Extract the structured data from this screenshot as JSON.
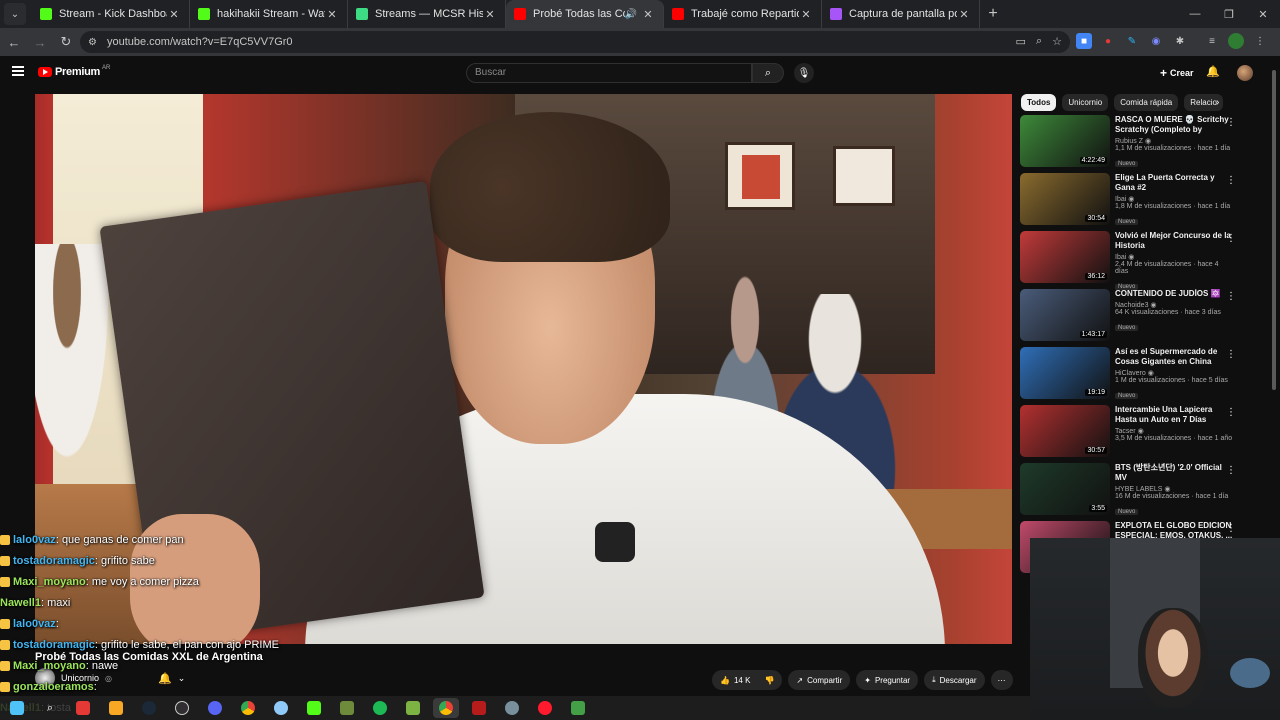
{
  "browser": {
    "tabs": [
      {
        "title": "Stream - Kick Dashboard",
        "icon": "kick-icon",
        "color": "#53fc18"
      },
      {
        "title": "hakihakii Stream - Watch Live o",
        "icon": "kick-icon",
        "color": "#53fc18"
      },
      {
        "title": "Streams — MCSR Hispano",
        "icon": "mcsr-icon",
        "color": "#3ddc84"
      },
      {
        "title": "Probé Todas las Comidas X",
        "icon": "youtube-icon",
        "color": "#ff0000",
        "active": true,
        "audio": true
      },
      {
        "title": "Trabajé como Repartidor de Co",
        "icon": "youtube-icon",
        "color": "#ff0000"
      },
      {
        "title": "Captura de pantalla por Lightsh",
        "icon": "lightshot-icon",
        "color": "#a855f7"
      }
    ],
    "url": "youtube.com/watch?v=E7qC5VV7Gr0"
  },
  "yt": {
    "logo": "Premium",
    "logo_country": "AR",
    "search_placeholder": "Buscar",
    "create_label": "Crear",
    "video_title": "Probé Todas las Comidas XXL de Argentina",
    "channel": "Unicornio",
    "likes": "14 K",
    "share": "Compartir",
    "ask": "Preguntar",
    "download": "Descargar",
    "chips": [
      "Todos",
      "Unicornio",
      "Comida rápida",
      "Relacio"
    ]
  },
  "recs": [
    {
      "title": "RASCA O MUERE 💀 Scritchy Scratchy (Completo by Rubius)",
      "channel": "Rubius Z",
      "meta": "1,1 M de visualizaciones · hace 1 día",
      "badge": "Nuevo",
      "duration": "4:22:49",
      "thumb": "#3d8a3a"
    },
    {
      "title": "Elige La Puerta Correcta y Gana #2",
      "channel": "Ibai",
      "meta": "1,8 M de visualizaciones · hace 1 día",
      "badge": "Nuevo",
      "duration": "30:54",
      "thumb": "#8a6b2e"
    },
    {
      "title": "Volvió el Mejor Concurso de la Historia",
      "channel": "Ibai",
      "meta": "2,4 M de visualizaciones · hace 4 días",
      "badge": "Nuevo",
      "duration": "36:12",
      "thumb": "#c23a3a"
    },
    {
      "title": "CONTENIDO DE JUDÍOS 🔯",
      "channel": "Nachoide3",
      "meta": "64 K visualizaciones · hace 3 días",
      "badge": "Nuevo",
      "duration": "1:43:17",
      "thumb": "#4a5c7a"
    },
    {
      "title": "Así es el Supermercado de Cosas Gigantes en China",
      "channel": "HiClavero",
      "meta": "1 M de visualizaciones · hace 5 días",
      "badge": "Nuevo",
      "duration": "19:19",
      "thumb": "#2f6fb8"
    },
    {
      "title": "Intercambie Una Lapicera Hasta un Auto en 7 Días",
      "channel": "Tacser",
      "meta": "3,5 M de visualizaciones · hace 1 año",
      "badge": "",
      "duration": "30:57",
      "thumb": "#b33030"
    },
    {
      "title": "BTS (방탄소년단) '2.0' Official MV",
      "channel": "HYBE LABELS",
      "meta": "16 M de visualizaciones · hace 1 día",
      "badge": "Nuevo",
      "duration": "3:55",
      "thumb": "#1e3a2a"
    },
    {
      "title": "EXPLOTA EL GLOBO EDICION ESPECIAL: EMOS, OTAKUS, ...",
      "channel": "",
      "meta": "",
      "badge": "",
      "duration": "",
      "thumb": "#c04a6a"
    }
  ],
  "chat": [
    {
      "user": "lalo0vaz",
      "msg": "que ganas de comer pan",
      "color": "blue",
      "badges": true
    },
    {
      "user": "tostadoramagic",
      "msg": "grifito sabe",
      "color": "blue",
      "badges": true
    },
    {
      "user": "Maxi_moyano",
      "msg": "me voy a comer pizza",
      "color": "green",
      "badges": true
    },
    {
      "user": "Nawell1",
      "msg": "maxi",
      "color": "green",
      "badges": false
    },
    {
      "user": "lalo0vaz",
      "msg": "",
      "color": "blue",
      "badges": true
    },
    {
      "user": "tostadoramagic",
      "msg": "grifito le sabe, el pan con ajo PRIME",
      "color": "blue",
      "badges": true
    },
    {
      "user": "Maxi_moyano",
      "msg": "nawe",
      "color": "green",
      "badges": true
    },
    {
      "user": "gonzaloeramos",
      "msg": "",
      "color": "green",
      "badges": true
    },
    {
      "user": "Nawell1",
      "msg": "tosta",
      "color": "green",
      "badges": false
    }
  ]
}
